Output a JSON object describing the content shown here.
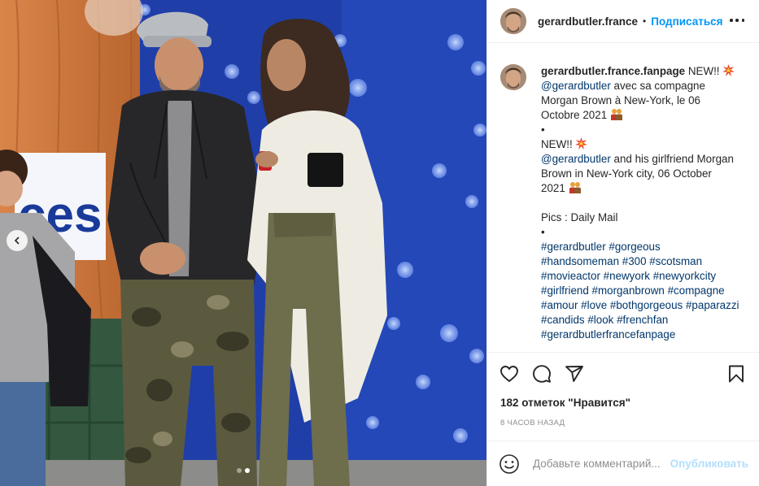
{
  "post": {
    "author": "gerardbutler.france",
    "separator": "•",
    "follow_label": "Подписаться",
    "more_icon": "more-dots-icon"
  },
  "photo": {
    "sign_text": "ces",
    "carousel": {
      "slides": 2,
      "active_index": 1
    },
    "colors": {
      "backdrop": "#1f3ea8",
      "wall": "#c7733b"
    }
  },
  "caption": {
    "username": "gerardbutler.france.fanpage",
    "line1_text": "NEW!!",
    "line2_mention": "@gerardbutler",
    "line2_rest": "avec sa compagne",
    "line3": "Morgan Brown à New-York, le 06",
    "line4": "Octobre 2021",
    "bullet1": "•",
    "line5": "NEW!!",
    "line6_mention": "@gerardbutler",
    "line6_rest": "and his girlfriend Morgan",
    "line7": "Brown in New-York city, 06 October",
    "line8": "2021",
    "credits": "Pics : Daily Mail",
    "bullet2": "•",
    "hashtags": [
      [
        "#gerardbutler",
        "#gorgeous"
      ],
      [
        "#handsomeman",
        "#300",
        "#scotsman"
      ],
      [
        "#movieactor",
        "#newyork",
        "#newyorkcity"
      ],
      [
        "#girlfriend",
        "#morganbrown",
        "#compagne"
      ],
      [
        "#amour",
        "#love",
        "#bothgorgeous",
        "#paparazzi"
      ],
      [
        "#candids",
        "#look",
        "#frenchfan"
      ],
      [
        "#gerardbutlerfrancefanpage"
      ]
    ]
  },
  "actions": {
    "like_icon": "heart-icon",
    "comment_icon": "comment-icon",
    "share_icon": "share-icon",
    "save_icon": "bookmark-icon"
  },
  "likes_text": "182 отметок \"Нравится\"",
  "timestamp": "8 ЧАСОВ НАЗАД",
  "comment": {
    "placeholder": "Добавьте комментарий...",
    "publish_label": "Опубликовать"
  }
}
